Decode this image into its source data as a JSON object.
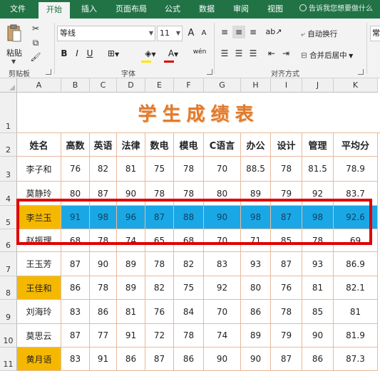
{
  "ribbon": {
    "tabs": [
      "文件",
      "开始",
      "插入",
      "页面布局",
      "公式",
      "数据",
      "审阅",
      "视图"
    ],
    "active_tab": "开始",
    "tell_me": "告诉我您想要做什么",
    "clipboard": {
      "paste": "粘贴",
      "group": "剪贴板"
    },
    "font": {
      "name": "等线",
      "size": "11",
      "group": "字体",
      "bold": "B",
      "italic": "I",
      "underline": "U",
      "grow": "A",
      "shrink": "A",
      "color_a": "A",
      "wen": "wén"
    },
    "alignment": {
      "wrap_text": "自动换行",
      "merge_center": "合并后居中",
      "group": "对齐方式"
    },
    "number": {
      "format": "常"
    }
  },
  "sheet": {
    "columns": [
      "A",
      "B",
      "C",
      "D",
      "E",
      "F",
      "G",
      "H",
      "I",
      "J",
      "K"
    ],
    "rows": [
      "1",
      "2",
      "3",
      "4",
      "5",
      "6",
      "7",
      "8",
      "9",
      "10",
      "11"
    ],
    "title": "学生成绩表",
    "headers": [
      "姓名",
      "高数",
      "英语",
      "法律",
      "数电",
      "模电",
      "C语言",
      "办公",
      "设计",
      "管理",
      "平均分"
    ],
    "data": [
      [
        "李子和",
        "76",
        "82",
        "81",
        "75",
        "78",
        "70",
        "88.5",
        "78",
        "81.5",
        "78.9"
      ],
      [
        "莫静玲",
        "80",
        "87",
        "90",
        "78",
        "78",
        "80",
        "89",
        "79",
        "92",
        "83.7"
      ],
      [
        "李兰玉",
        "91",
        "98",
        "96",
        "87",
        "88",
        "90",
        "98",
        "87",
        "98",
        "92.6"
      ],
      [
        "赵振理",
        "68",
        "78",
        "74",
        "65",
        "68",
        "70",
        "71",
        "85",
        "78",
        "69"
      ],
      [
        "王玉芳",
        "87",
        "90",
        "89",
        "78",
        "82",
        "83",
        "93",
        "87",
        "93",
        "86.9"
      ],
      [
        "王佳和",
        "86",
        "78",
        "89",
        "82",
        "75",
        "92",
        "80",
        "76",
        "81",
        "82.1"
      ],
      [
        "刘海玲",
        "83",
        "86",
        "81",
        "76",
        "84",
        "70",
        "86",
        "78",
        "85",
        "81"
      ],
      [
        "莫思云",
        "87",
        "77",
        "91",
        "72",
        "78",
        "74",
        "89",
        "79",
        "90",
        "81.9"
      ],
      [
        "黄月语",
        "83",
        "91",
        "86",
        "87",
        "86",
        "90",
        "90",
        "87",
        "86",
        "87.3"
      ]
    ],
    "highlight_color": "#1aa7e6",
    "name_highlight_color": "#f5b800",
    "selection_box_color": "#e00000"
  }
}
